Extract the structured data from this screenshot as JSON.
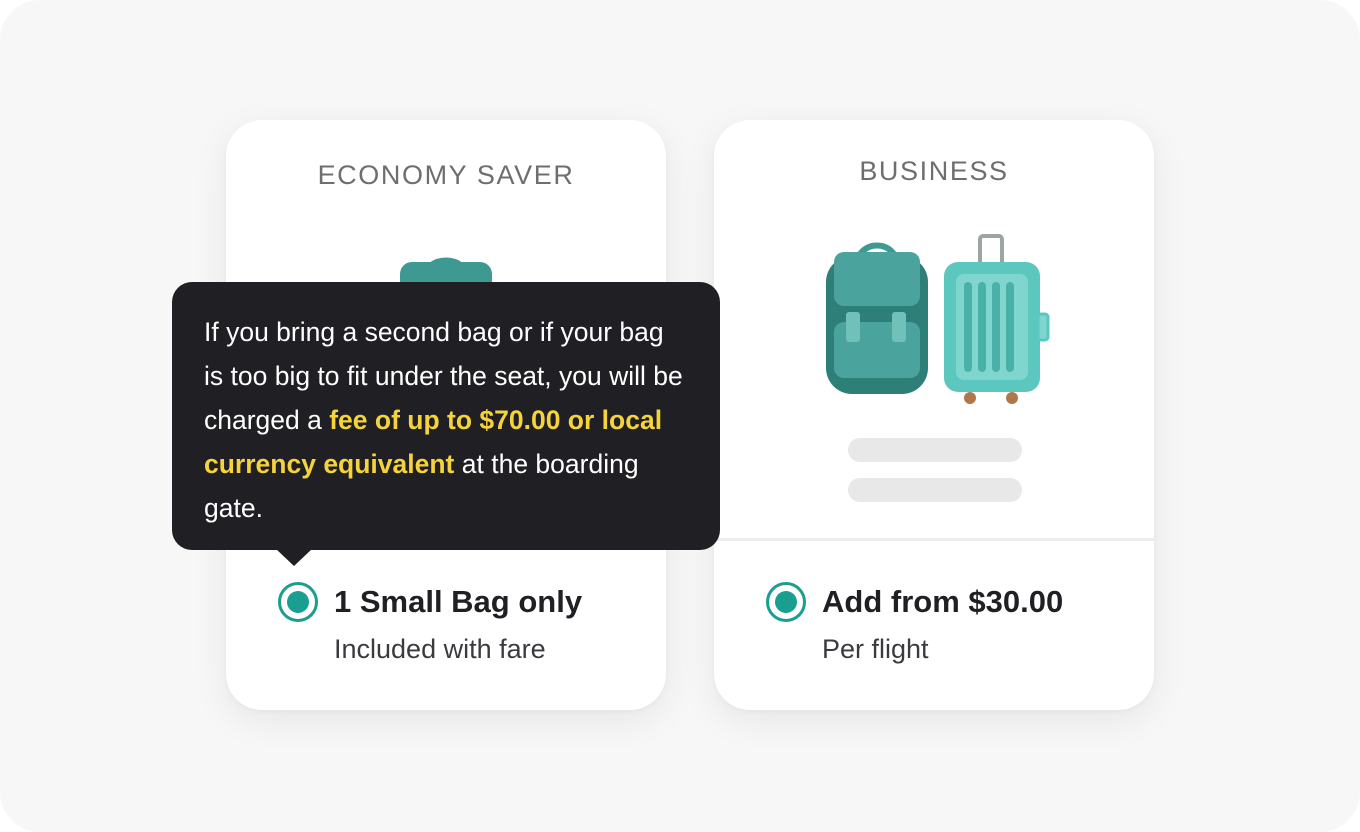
{
  "plans": {
    "economy": {
      "title": "ECONOMY SAVER",
      "option_label": "1 Small Bag only",
      "option_sub": "Included with fare",
      "selected": true,
      "illustration": "backpack-icon"
    },
    "business": {
      "title": "BUSINESS",
      "option_label": "Add from $30.00",
      "option_sub": "Per flight",
      "selected": true,
      "illustration": [
        "backpack-icon",
        "suitcase-icon"
      ]
    }
  },
  "tooltip": {
    "text_before": "If you bring a second bag or if your bag is too big to fit under the seat, you will be charged a ",
    "highlight": "fee of up to $70.00 or local currency equivalent",
    "text_after": " at the boarding gate."
  },
  "colors": {
    "accent": "#1a9e8f",
    "tooltip_bg": "#1f1f24",
    "highlight": "#f5d33c",
    "backpack": "#3e9992",
    "suitcase": "#5cc7bf"
  }
}
